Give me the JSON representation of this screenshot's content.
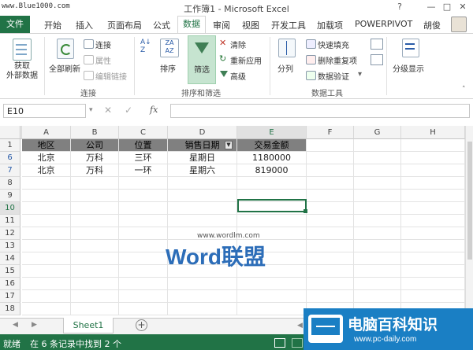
{
  "window": {
    "title": "工作簿1 - Microsoft Excel",
    "watermark_url": "www.Blue1000.com",
    "help": "?",
    "minimize": "—",
    "restore": "□",
    "close": "✕"
  },
  "tabs": {
    "file": "文件",
    "items": [
      "开始",
      "插入",
      "页面布局",
      "公式",
      "数据",
      "审阅",
      "视图",
      "开发工具",
      "加载项",
      "POWERPIVOT"
    ],
    "active": "数据",
    "user": "胡俊"
  },
  "ribbon": {
    "get_external": "获取\n外部数据",
    "refresh_all": "全部刷新",
    "connections": "连接",
    "properties": "属性",
    "edit_links": "编辑链接",
    "group_connections": "连接",
    "sort": "排序",
    "filter": "筛选",
    "clear": "清除",
    "reapply": "重新应用",
    "advanced": "高级",
    "group_sort_filter": "排序和筛选",
    "text_to_columns": "分列",
    "flash_fill": "快速填充",
    "remove_duplicates": "删除重复项",
    "data_validation": "数据验证",
    "group_data_tools": "数据工具",
    "outline": "分级显示"
  },
  "formula_bar": {
    "name_box": "E10",
    "fx": "fx",
    "value": ""
  },
  "grid": {
    "columns": [
      "A",
      "B",
      "C",
      "D",
      "E",
      "F",
      "G",
      "H"
    ],
    "rows": [
      "1",
      "6",
      "7",
      "8",
      "9",
      "10",
      "11",
      "12",
      "13",
      "14",
      "15",
      "16",
      "17",
      "18"
    ],
    "header": [
      "地区",
      "公司",
      "位置",
      "销售日期",
      "交易金额"
    ],
    "data": [
      [
        "北京",
        "万科",
        "三环",
        "星期日",
        "1180000"
      ],
      [
        "北京",
        "万科",
        "一环",
        "星期六",
        "819000"
      ]
    ],
    "active_cell": "E10"
  },
  "sheets": {
    "active": "Sheet1",
    "add": "+"
  },
  "status": {
    "mode": "就绪",
    "message": "在 6 条记录中找到 2 个"
  },
  "overlay_logo": {
    "wordlm_url": "www.wordlm.com",
    "wordlm_text": "Word联盟",
    "pcdaily_name": "电脑百科知识",
    "pcdaily_url": "www.pc-daily.com"
  }
}
